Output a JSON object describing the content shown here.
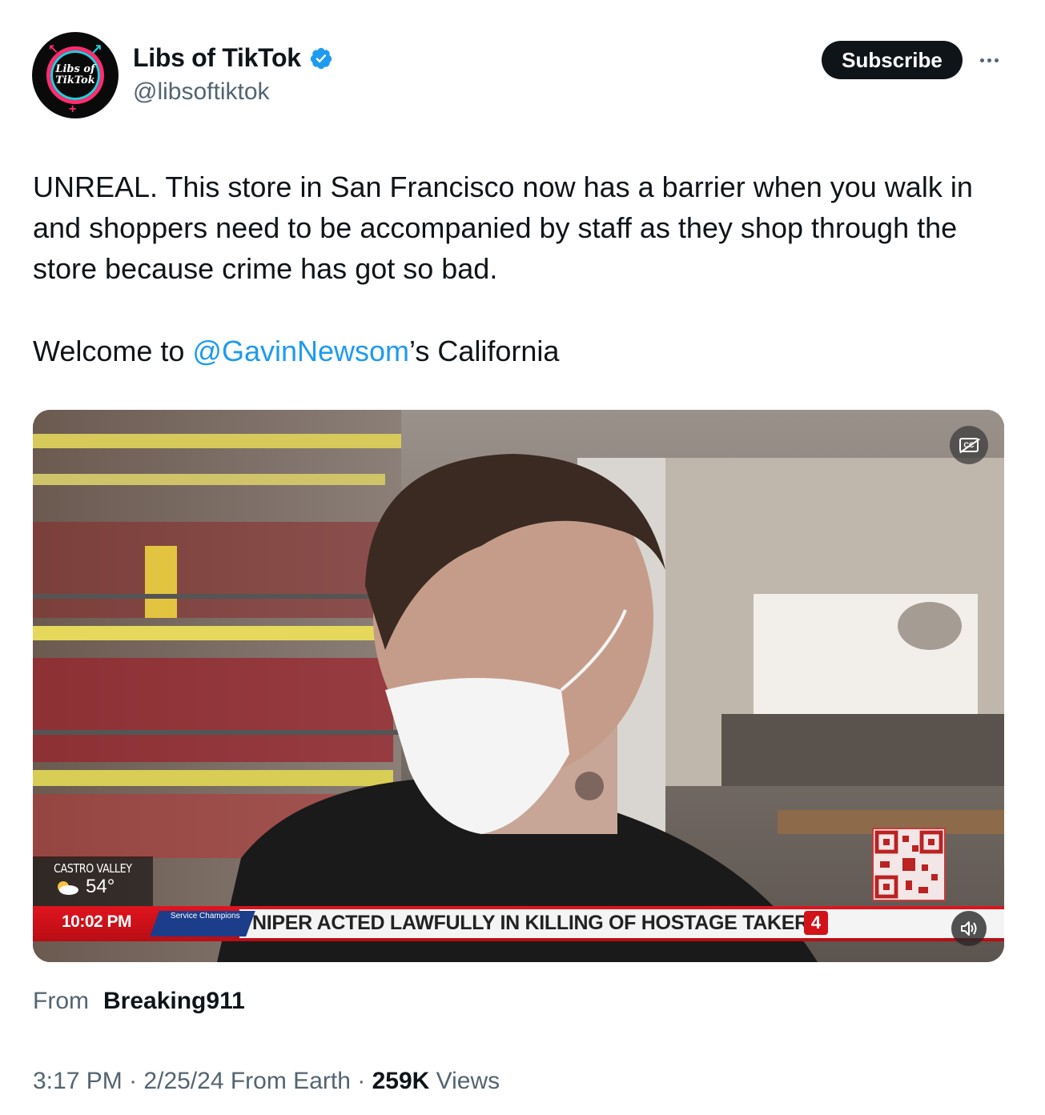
{
  "author": {
    "display_name": "Libs of TikTok",
    "handle": "@libsoftiktok",
    "avatar_text_line1": "Libs of",
    "avatar_text_line2": "TikTok",
    "verified_icon": "verified-badge-icon"
  },
  "header": {
    "subscribe_label": "Subscribe",
    "more_icon": "more-icon"
  },
  "tweet": {
    "paragraph1": "UNREAL. This store in San Francisco now has a barrier when you walk in and shoppers need to be accompanied by staff as they shop through the store because crime has got so bad.",
    "paragraph2_prefix": "Welcome to ",
    "mention": "@GavinNewsom",
    "paragraph2_suffix": "’s California"
  },
  "video": {
    "weather_location": "CASTRO VALLEY",
    "weather_temp": "54°",
    "ticker_time": "10:02 PM",
    "ticker_sponsor": "Service Champions",
    "ticker_headline": "NIPER ACTED LAWFULLY IN KILLING OF HOSTAGE TAKER",
    "ticker_logo": "4",
    "cc_label": "CC",
    "captions_icon": "captions-off-icon",
    "mute_icon": "speaker-icon"
  },
  "source": {
    "from_label": "From",
    "from_name": "Breaking911"
  },
  "meta": {
    "time": "3:17 PM",
    "date": "2/25/24",
    "location": "From Earth",
    "views_count": "259K",
    "views_label": "Views",
    "separator": "·"
  },
  "colors": {
    "link": "#1d9bf0",
    "text": "#0f1419",
    "secondary": "#536471",
    "ticker_red": "#e0141e"
  }
}
